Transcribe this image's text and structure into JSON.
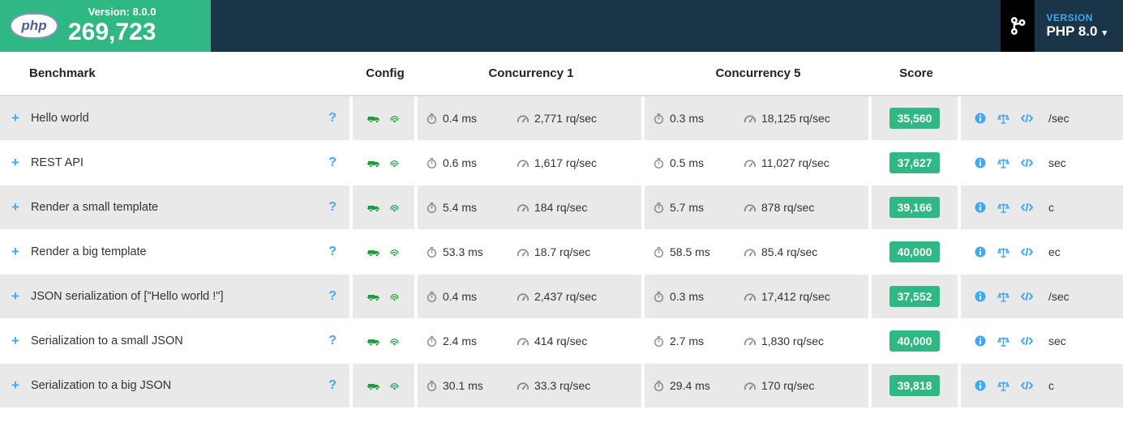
{
  "header": {
    "logo_text": "php",
    "version_label": "Version: 8.0.0",
    "total_score": "269,723",
    "version_heading": "VERSION",
    "version_value": "PHP 8.0"
  },
  "columns": {
    "benchmark": "Benchmark",
    "config": "Config",
    "conc1": "Concurrency 1",
    "conc5": "Concurrency 5",
    "score": "Score"
  },
  "rows": [
    {
      "name": "Hello world",
      "c1_time": "0.4 ms",
      "c1_rq": "2,771 rq/sec",
      "c5_time": "0.3 ms",
      "c5_rq": "18,125 rq/sec",
      "score": "35,560",
      "tail": "/sec"
    },
    {
      "name": "REST API",
      "c1_time": "0.6 ms",
      "c1_rq": "1,617 rq/sec",
      "c5_time": "0.5 ms",
      "c5_rq": "11,027 rq/sec",
      "score": "37,627",
      "tail": "sec"
    },
    {
      "name": "Render a small template",
      "c1_time": "5.4 ms",
      "c1_rq": "184 rq/sec",
      "c5_time": "5.7 ms",
      "c5_rq": "878 rq/sec",
      "score": "39,166",
      "tail": "c"
    },
    {
      "name": "Render a big template",
      "c1_time": "53.3 ms",
      "c1_rq": "18.7 rq/sec",
      "c5_time": "58.5 ms",
      "c5_rq": "85.4 rq/sec",
      "score": "40,000",
      "tail": "ec"
    },
    {
      "name": "JSON serialization of [\"Hello world !\"]",
      "c1_time": "0.4 ms",
      "c1_rq": "2,437 rq/sec",
      "c5_time": "0.3 ms",
      "c5_rq": "17,412 rq/sec",
      "score": "37,552",
      "tail": "/sec"
    },
    {
      "name": "Serialization to a small JSON",
      "c1_time": "2.4 ms",
      "c1_rq": "414 rq/sec",
      "c5_time": "2.7 ms",
      "c5_rq": "1,830 rq/sec",
      "score": "40,000",
      "tail": "sec"
    },
    {
      "name": "Serialization to a big JSON",
      "c1_time": "30.1 ms",
      "c1_rq": "33.3 rq/sec",
      "c5_time": "29.4 ms",
      "c5_rq": "170 rq/sec",
      "score": "39,818",
      "tail": "c"
    }
  ]
}
